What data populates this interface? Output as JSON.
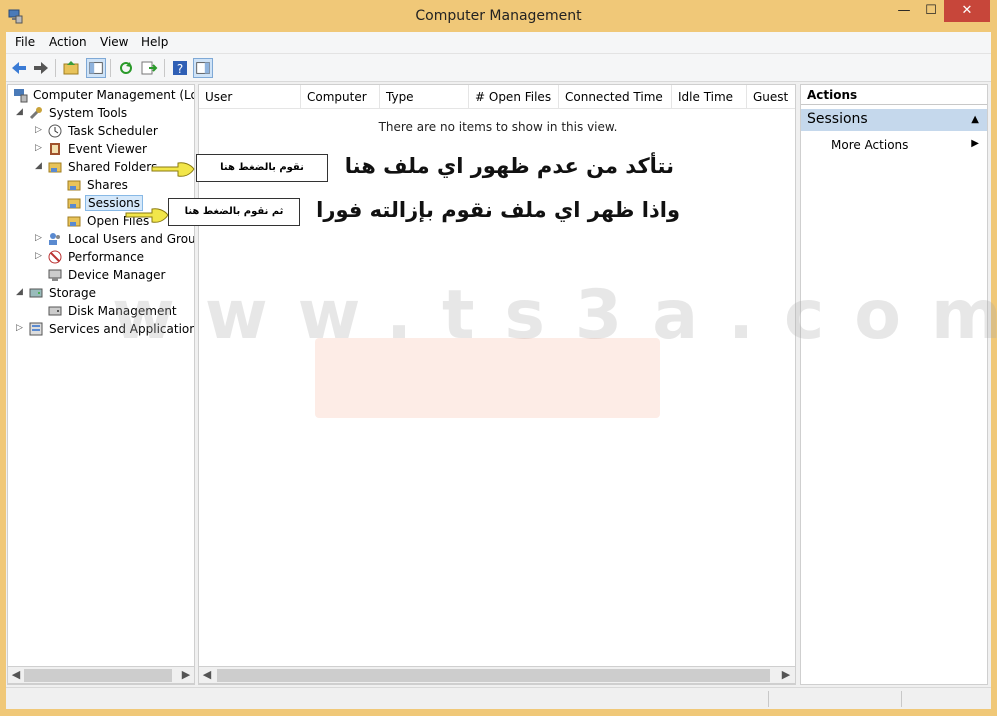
{
  "window": {
    "title": "Computer Management",
    "min": "—",
    "max": "☐",
    "close": "✕"
  },
  "menu": [
    "File",
    "Action",
    "View",
    "Help"
  ],
  "tree": [
    {
      "label": "Computer Management (Local",
      "arrow": ""
    },
    {
      "label": "System Tools",
      "arrow": "◢"
    },
    {
      "label": "Task Scheduler",
      "arrow": "▷"
    },
    {
      "label": "Event Viewer",
      "arrow": "▷"
    },
    {
      "label": "Shared Folders",
      "arrow": "◢"
    },
    {
      "label": "Shares",
      "arrow": ""
    },
    {
      "label": "Sessions",
      "arrow": ""
    },
    {
      "label": "Open Files",
      "arrow": ""
    },
    {
      "label": "Local Users and Groups",
      "arrow": "▷"
    },
    {
      "label": "Performance",
      "arrow": "▷"
    },
    {
      "label": "Device Manager",
      "arrow": ""
    },
    {
      "label": "Storage",
      "arrow": "◢"
    },
    {
      "label": "Disk Management",
      "arrow": ""
    },
    {
      "label": "Services and Applications",
      "arrow": "▷"
    }
  ],
  "columns": [
    "User",
    "Computer",
    "Type",
    "# Open Files",
    "Connected Time",
    "Idle Time",
    "Guest"
  ],
  "empty_message": "There are no items to show in this view.",
  "actions": {
    "header": "Actions",
    "section": "Sessions",
    "more": "More Actions"
  },
  "callouts": {
    "first": "نقوم بالضغط هنا",
    "second": "ثم نقوم بالضغط هنا"
  },
  "overlay": {
    "line1": "نتأكد من عدم ظهور اي ملف هنا",
    "line2": "واذا ظهر اي ملف نقوم بإزالته فورا"
  },
  "watermark": "www.ts3a.com",
  "colors": {
    "titlebar": "#f0c878",
    "close": "#c7463a",
    "selection": "#d5e8fa",
    "section": "#c5d8ec"
  }
}
